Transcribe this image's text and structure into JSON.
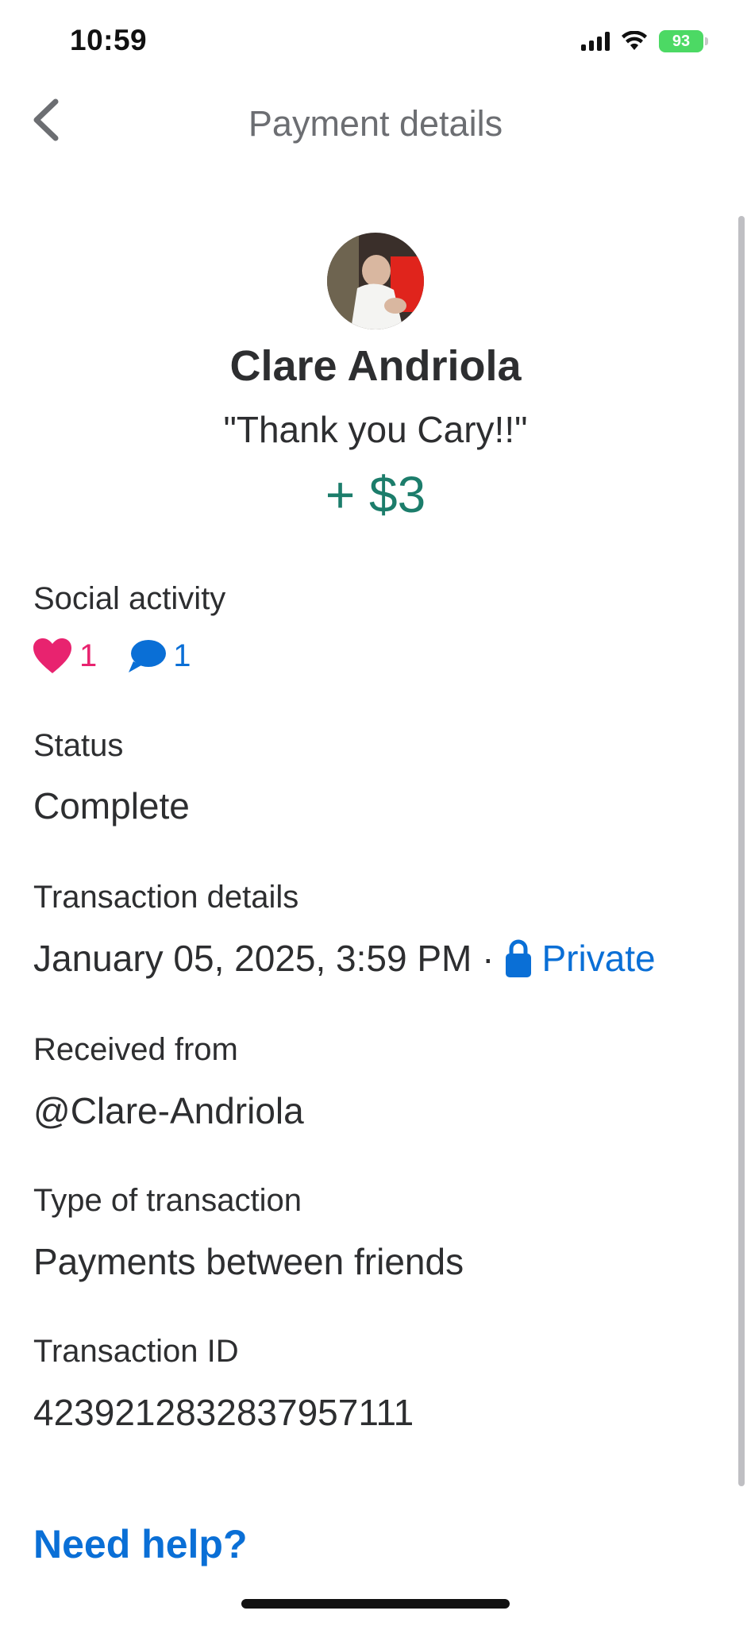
{
  "status_bar": {
    "time": "10:59",
    "battery": "93"
  },
  "header": {
    "title": "Payment details"
  },
  "profile": {
    "name": "Clare Andriola",
    "note": "\"Thank you Cary!!\"",
    "amount": "+ $3"
  },
  "social": {
    "label": "Social activity",
    "likes": "1",
    "comments": "1"
  },
  "status": {
    "label": "Status",
    "value": "Complete"
  },
  "transaction_details": {
    "label": "Transaction details",
    "datetime": "January 05, 2025, 3:59 PM ·",
    "privacy": "Private"
  },
  "received_from": {
    "label": "Received from",
    "value": "@Clare-Andriola"
  },
  "type": {
    "label": "Type of transaction",
    "value": "Payments between friends"
  },
  "transaction_id": {
    "label": "Transaction ID",
    "value": "4239212832837957111"
  },
  "help": {
    "label": "Need help?"
  },
  "colors": {
    "amount": "#1c7d6b",
    "like": "#e8236f",
    "link": "#0a6fd6"
  },
  "icons": [
    "back-chevron-icon",
    "signal-icon",
    "wifi-icon",
    "battery-icon",
    "heart-icon",
    "comment-icon",
    "lock-icon"
  ]
}
